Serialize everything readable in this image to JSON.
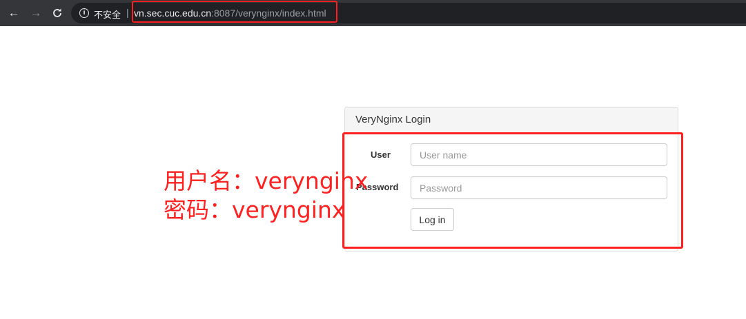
{
  "browser": {
    "security_label": "不安全",
    "separator": "|",
    "url_host": "vn.sec.cuc.edu.cn",
    "url_rest": ":8087/verynginx/index.html",
    "nav_icons": [
      "back-arrow-icon",
      "forward-arrow-icon",
      "reload-icon",
      "info-icon"
    ]
  },
  "panel": {
    "heading": "VeryNginx Login",
    "user_label": "User",
    "user_placeholder": "User name",
    "password_label": "Password",
    "password_placeholder": "Password",
    "login_button": "Log in"
  },
  "annotation": {
    "line1": "用户名：verynginx",
    "line2": "密码：verynginx",
    "color": "#ff2020"
  }
}
